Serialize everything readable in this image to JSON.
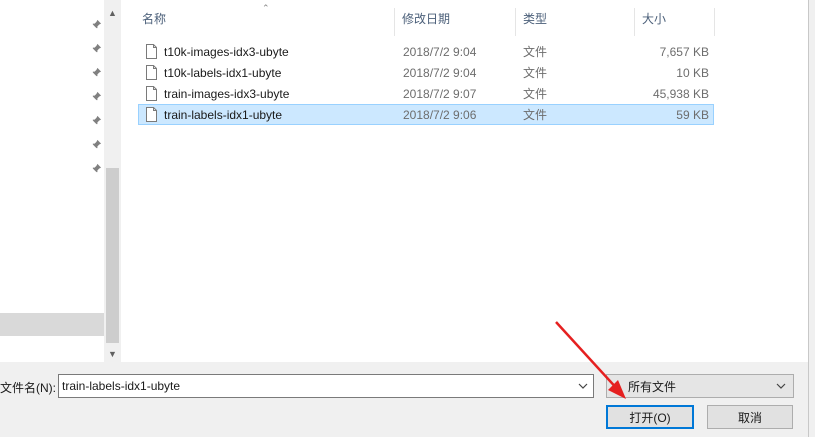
{
  "nav": {
    "pin_count": 7
  },
  "columns": {
    "name": "名称",
    "date": "修改日期",
    "type": "类型",
    "size": "大小"
  },
  "files": [
    {
      "name": "t10k-images-idx3-ubyte",
      "date": "2018/7/2 9:04",
      "type": "文件",
      "size": "7,657 KB",
      "selected": false
    },
    {
      "name": "t10k-labels-idx1-ubyte",
      "date": "2018/7/2 9:04",
      "type": "文件",
      "size": "10 KB",
      "selected": false
    },
    {
      "name": "train-images-idx3-ubyte",
      "date": "2018/7/2 9:07",
      "type": "文件",
      "size": "45,938 KB",
      "selected": false
    },
    {
      "name": "train-labels-idx1-ubyte",
      "date": "2018/7/2 9:06",
      "type": "文件",
      "size": "59 KB",
      "selected": true
    }
  ],
  "footer": {
    "filename_label": "文件名(N):",
    "filename_value": "train-labels-idx1-ubyte",
    "filetype_value": "所有文件",
    "open_label": "打开(O)",
    "cancel_label": "取消"
  },
  "icons": {
    "pin": "pin-icon",
    "file": "file-icon",
    "dropdown": "chevron-down-icon",
    "annotation": "red-arrow"
  },
  "colors": {
    "selection_bg": "#cce8ff",
    "selection_border": "#99d1ff",
    "primary_border": "#0078d7",
    "annotation": "#e52020"
  }
}
